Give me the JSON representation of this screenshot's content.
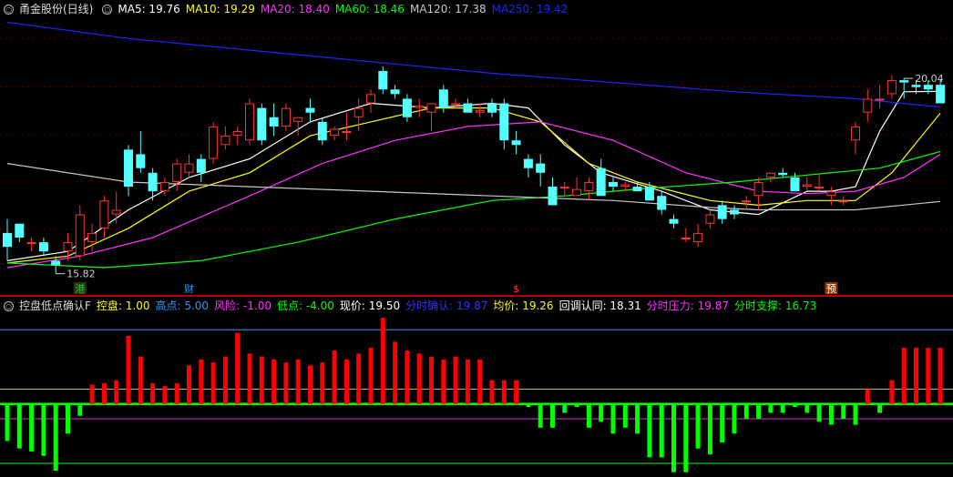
{
  "top_legend": {
    "name": "甬金股份(日线)",
    "items": [
      {
        "label": "MA5: 19.76",
        "color": "#ffffff"
      },
      {
        "label": "MA10: 19.29",
        "color": "#ffff00"
      },
      {
        "label": "MA20: 18.40",
        "color": "#ff33ff"
      },
      {
        "label": "MA60: 18.46",
        "color": "#00ff00"
      },
      {
        "label": "MA120: 17.38",
        "color": "#c8c8c8"
      },
      {
        "label": "MA250: 19.42",
        "color": "#2222ff"
      }
    ]
  },
  "bottom_legend": {
    "name": "控盘低点确认F",
    "items": [
      {
        "label": "控盘: 1.00",
        "color": "#ffff00"
      },
      {
        "label": "高点: 5.00",
        "color": "#3399ff"
      },
      {
        "label": "风险: -1.00",
        "color": "#ff33ff"
      },
      {
        "label": "低点: -4.00",
        "color": "#00ff00"
      },
      {
        "label": "现价: 19.50",
        "color": "#ffffff"
      },
      {
        "label": "分时确认: 19.87",
        "color": "#3333ff"
      },
      {
        "label": "均价: 19.26",
        "color": "#ffff00"
      },
      {
        "label": "回调认同: 18.31",
        "color": "#ffffff"
      },
      {
        "label": "分时压力: 19.87",
        "color": "#ff33ff"
      },
      {
        "label": "分时支撑: 16.73",
        "color": "#00ff00"
      }
    ]
  },
  "annotations": {
    "low_label": "15.82",
    "high_label": "20.04",
    "markers": [
      {
        "text": "港",
        "color": "#00cc44",
        "bg": "#333300"
      },
      {
        "text": "财",
        "color": "#3399ff",
        "bg": "#000000"
      },
      {
        "text": "$",
        "color": "#ff3333",
        "bg": "#000000"
      },
      {
        "text": "预",
        "color": "#ffffff",
        "bg": "#993300"
      }
    ]
  },
  "colors": {
    "up": "#ff3333",
    "down": "#54ffff",
    "osc_up": "#ff0000",
    "osc_down": "#00ff00",
    "grid": "#8b0000"
  },
  "chart_data": [
    {
      "type": "candlestick",
      "title": "甬金股份(日线)",
      "ylim": [
        15.4,
        21.3
      ],
      "candles": [
        [
          16.7,
          17.0,
          16.1,
          16.4
        ],
        [
          16.9,
          16.9,
          16.5,
          16.6
        ],
        [
          16.5,
          16.6,
          16.3,
          16.5
        ],
        [
          16.5,
          16.6,
          16.2,
          16.3
        ],
        [
          16.1,
          16.2,
          15.82,
          16.0
        ],
        [
          16.3,
          16.7,
          16.1,
          16.5
        ],
        [
          16.2,
          17.3,
          16.1,
          17.1
        ],
        [
          16.5,
          16.9,
          16.3,
          16.7
        ],
        [
          16.8,
          17.5,
          16.6,
          17.4
        ],
        [
          17.1,
          17.6,
          16.9,
          17.2
        ],
        [
          18.5,
          18.6,
          17.5,
          17.7
        ],
        [
          18.4,
          18.9,
          18.0,
          18.1
        ],
        [
          18.0,
          18.1,
          17.4,
          17.6
        ],
        [
          17.6,
          17.9,
          17.5,
          17.8
        ],
        [
          17.8,
          18.3,
          17.6,
          18.2
        ],
        [
          18.0,
          18.4,
          17.9,
          18.2
        ],
        [
          18.3,
          18.4,
          17.8,
          18.0
        ],
        [
          18.3,
          19.1,
          18.2,
          19.0
        ],
        [
          18.6,
          19.0,
          18.5,
          18.8
        ],
        [
          18.8,
          19.0,
          18.6,
          18.9
        ],
        [
          18.7,
          19.6,
          18.6,
          19.5
        ],
        [
          19.4,
          19.5,
          18.6,
          18.7
        ],
        [
          19.2,
          19.5,
          18.8,
          19.0
        ],
        [
          19.0,
          19.5,
          18.9,
          19.4
        ],
        [
          19.1,
          19.2,
          18.8,
          19.2
        ],
        [
          19.4,
          19.6,
          19.1,
          19.3
        ],
        [
          19.1,
          19.2,
          18.6,
          18.7
        ],
        [
          18.8,
          19.0,
          18.7,
          18.95
        ],
        [
          18.9,
          19.3,
          18.7,
          18.9
        ],
        [
          19.2,
          19.6,
          18.9,
          19.4
        ],
        [
          19.5,
          19.8,
          19.3,
          19.7
        ],
        [
          20.2,
          20.3,
          19.7,
          19.8
        ],
        [
          19.8,
          19.9,
          19.6,
          19.7
        ],
        [
          19.6,
          19.7,
          19.1,
          19.2
        ],
        [
          19.4,
          19.6,
          19.2,
          19.45
        ],
        [
          19.3,
          19.5,
          18.9,
          19.5
        ],
        [
          19.8,
          19.9,
          19.3,
          19.4
        ],
        [
          19.5,
          19.6,
          19.4,
          19.5
        ],
        [
          19.5,
          19.6,
          19.3,
          19.3
        ],
        [
          19.3,
          19.5,
          19.2,
          19.35
        ],
        [
          19.5,
          19.6,
          19.2,
          19.3
        ],
        [
          19.5,
          19.6,
          18.5,
          18.7
        ],
        [
          18.7,
          18.9,
          18.4,
          18.6
        ],
        [
          18.3,
          18.4,
          17.9,
          18.1
        ],
        [
          18.2,
          18.4,
          17.7,
          18.0
        ],
        [
          17.7,
          17.9,
          17.3,
          17.3
        ],
        [
          17.7,
          17.8,
          17.5,
          17.7
        ],
        [
          17.5,
          17.9,
          17.5,
          17.65
        ],
        [
          17.6,
          17.9,
          17.4,
          17.8
        ],
        [
          18.1,
          18.3,
          17.5,
          17.5
        ],
        [
          17.8,
          17.9,
          17.6,
          17.7
        ],
        [
          17.7,
          17.8,
          17.6,
          17.75
        ],
        [
          17.7,
          17.8,
          17.6,
          17.6
        ],
        [
          17.7,
          17.8,
          17.4,
          17.4
        ],
        [
          17.5,
          17.6,
          17.1,
          17.2
        ],
        [
          17.0,
          17.1,
          16.8,
          16.9
        ],
        [
          16.6,
          16.8,
          16.5,
          16.6
        ],
        [
          16.5,
          16.9,
          16.4,
          16.7
        ],
        [
          16.9,
          17.2,
          16.8,
          17.1
        ],
        [
          17.3,
          17.4,
          16.9,
          17.0
        ],
        [
          17.2,
          17.3,
          17.0,
          17.1
        ],
        [
          17.4,
          17.5,
          17.2,
          17.4
        ],
        [
          17.5,
          17.9,
          17.2,
          17.8
        ],
        [
          17.9,
          18.0,
          17.8,
          18.0
        ],
        [
          18.0,
          18.1,
          17.9,
          17.95
        ],
        [
          17.9,
          18.0,
          17.6,
          17.6
        ],
        [
          17.7,
          17.9,
          17.6,
          17.75
        ],
        [
          17.7,
          18.0,
          17.6,
          17.7
        ],
        [
          17.5,
          17.7,
          17.3,
          17.6
        ],
        [
          17.4,
          17.5,
          17.3,
          17.4
        ],
        [
          18.7,
          19.1,
          18.4,
          19.0
        ],
        [
          19.3,
          19.8,
          19.1,
          19.6
        ],
        [
          19.6,
          19.9,
          19.4,
          19.6
        ],
        [
          19.7,
          20.1,
          19.6,
          20.0
        ],
        [
          20.0,
          20.04,
          19.6,
          19.95
        ],
        [
          19.9,
          20.0,
          19.7,
          19.85
        ],
        [
          19.9,
          20.0,
          19.7,
          19.8
        ],
        [
          19.9,
          20.0,
          19.5,
          19.5
        ]
      ],
      "ma": [
        {
          "name": "MA5",
          "values": [
            [
              0,
              16.1
            ],
            [
              5,
              16.3
            ],
            [
              10,
              17.2
            ],
            [
              15,
              17.9
            ],
            [
              20,
              18.3
            ],
            [
              25,
              19.1
            ],
            [
              30,
              19.5
            ],
            [
              35,
              19.4
            ],
            [
              40,
              19.5
            ],
            [
              43,
              19.4
            ],
            [
              46,
              18.6
            ],
            [
              49,
              18.0
            ],
            [
              54,
              17.6
            ],
            [
              58,
              17.2
            ],
            [
              62,
              17.1
            ],
            [
              66,
              17.6
            ],
            [
              68,
              17.6
            ],
            [
              70,
              17.7
            ],
            [
              72,
              18.9
            ],
            [
              74,
              19.75
            ],
            [
              77,
              19.76
            ]
          ]
        },
        {
          "name": "MA10",
          "values": [
            [
              0,
              16.05
            ],
            [
              5,
              16.2
            ],
            [
              10,
              16.8
            ],
            [
              15,
              17.6
            ],
            [
              20,
              18.0
            ],
            [
              25,
              18.8
            ],
            [
              30,
              19.1
            ],
            [
              35,
              19.4
            ],
            [
              40,
              19.4
            ],
            [
              44,
              19.1
            ],
            [
              48,
              18.2
            ],
            [
              52,
              17.8
            ],
            [
              58,
              17.4
            ],
            [
              62,
              17.3
            ],
            [
              66,
              17.4
            ],
            [
              70,
              17.4
            ],
            [
              73,
              18.0
            ],
            [
              77,
              19.29
            ]
          ]
        },
        {
          "name": "MA20",
          "values": [
            [
              0,
              15.95
            ],
            [
              6,
              16.2
            ],
            [
              12,
              16.6
            ],
            [
              20,
              17.5
            ],
            [
              26,
              18.2
            ],
            [
              32,
              18.7
            ],
            [
              38,
              19.0
            ],
            [
              44,
              19.1
            ],
            [
              50,
              18.7
            ],
            [
              56,
              18.0
            ],
            [
              62,
              17.6
            ],
            [
              66,
              17.55
            ],
            [
              70,
              17.6
            ],
            [
              74,
              17.9
            ],
            [
              77,
              18.4
            ]
          ]
        },
        {
          "name": "MA60",
          "values": [
            [
              0,
              16.05
            ],
            [
              8,
              15.95
            ],
            [
              16,
              16.1
            ],
            [
              24,
              16.5
            ],
            [
              32,
              17.0
            ],
            [
              40,
              17.4
            ],
            [
              46,
              17.5
            ],
            [
              52,
              17.65
            ],
            [
              60,
              17.8
            ],
            [
              66,
              17.95
            ],
            [
              72,
              18.1
            ],
            [
              77,
              18.46
            ]
          ]
        },
        {
          "name": "MA120",
          "values": [
            [
              0,
              18.2
            ],
            [
              10,
              17.8
            ],
            [
              20,
              17.7
            ],
            [
              30,
              17.6
            ],
            [
              40,
              17.5
            ],
            [
              50,
              17.4
            ],
            [
              58,
              17.25
            ],
            [
              62,
              17.2
            ],
            [
              70,
              17.2
            ],
            [
              77,
              17.38
            ]
          ]
        },
        {
          "name": "MA250",
          "values": [
            [
              0,
              21.25
            ],
            [
              10,
              20.9
            ],
            [
              20,
              20.65
            ],
            [
              30,
              20.4
            ],
            [
              40,
              20.15
            ],
            [
              50,
              19.95
            ],
            [
              60,
              19.75
            ],
            [
              70,
              19.6
            ],
            [
              77,
              19.42
            ]
          ]
        }
      ]
    },
    {
      "type": "bar",
      "title": "控盘低点确认F",
      "ylim": [
        -4.8,
        6.0
      ],
      "reference_lines": [
        {
          "value": 5.0,
          "color": "#3399ff"
        },
        {
          "value": 1.0,
          "color": "#ffff00"
        },
        {
          "value": -1.0,
          "color": "#ff33ff"
        },
        {
          "value": -4.0,
          "color": "#00ff00"
        }
      ],
      "values": [
        -2.5,
        -3.0,
        -3.2,
        -3.5,
        -4.5,
        -2.0,
        -0.8,
        1.3,
        1.4,
        1.6,
        4.6,
        3.2,
        1.4,
        1.2,
        1.4,
        2.6,
        3.0,
        2.8,
        3.2,
        4.8,
        3.4,
        3.2,
        3.0,
        2.8,
        3.0,
        2.6,
        2.8,
        3.6,
        3.0,
        3.4,
        3.8,
        5.8,
        4.2,
        3.6,
        3.4,
        3.2,
        3.0,
        3.2,
        3.0,
        3.0,
        1.6,
        1.6,
        1.6,
        -0.2,
        -1.6,
        -1.6,
        -0.6,
        -0.2,
        -1.6,
        -1.2,
        -2.0,
        -1.6,
        -2.0,
        -3.6,
        -3.6,
        -4.6,
        -4.6,
        -3.0,
        -3.4,
        -2.6,
        -2.0,
        -1.0,
        -1.0,
        -0.6,
        -0.6,
        -0.2,
        -0.6,
        -1.2,
        -1.4,
        -1.0,
        -1.4,
        1.0,
        -0.6,
        1.6,
        3.8,
        3.8,
        3.8,
        3.8
      ]
    }
  ]
}
